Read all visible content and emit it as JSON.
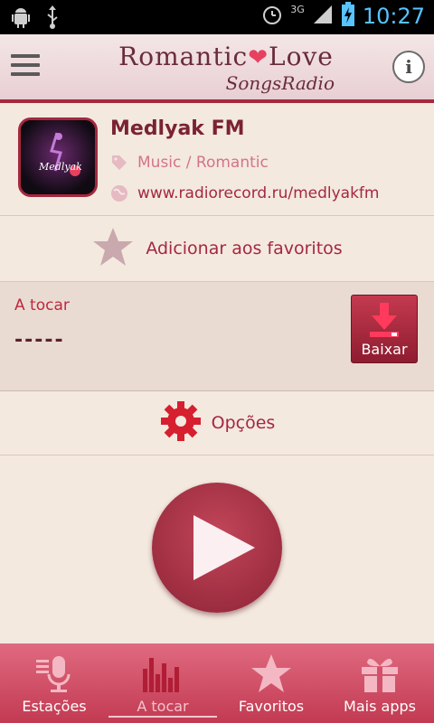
{
  "status_bar": {
    "network": "3G",
    "time": "10:27"
  },
  "header": {
    "brand_main_left": "Romantic",
    "brand_main_right": "Love",
    "brand_sub": "SongsRadio",
    "info_label": "i"
  },
  "station": {
    "name": "Medlyak FM",
    "genre": "Music / Romantic",
    "url": "www.radiorecord.ru/medlyakfm",
    "logo_text": "Medlyak"
  },
  "favorites": {
    "label": "Adicionar aos favoritos"
  },
  "now_playing": {
    "label": "A tocar",
    "track": "-----",
    "download_label": "Baixar"
  },
  "options": {
    "label": "Opções"
  },
  "tabs": [
    {
      "label": "Estações",
      "icon": "microphone-icon",
      "active": false
    },
    {
      "label": "A tocar",
      "icon": "equalizer-icon",
      "active": true
    },
    {
      "label": "Favoritos",
      "icon": "star-icon",
      "active": false
    },
    {
      "label": "Mais apps",
      "icon": "gift-icon",
      "active": false
    }
  ],
  "colors": {
    "accent": "#a5283e",
    "tab_bar": "#d4506a",
    "background": "#f3e9df"
  }
}
